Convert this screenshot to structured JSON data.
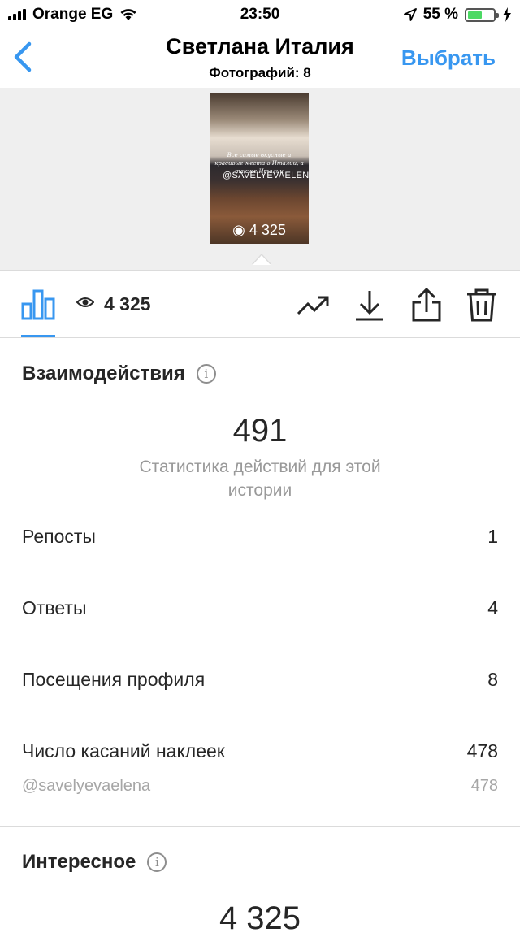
{
  "status": {
    "carrier": "Orange EG",
    "time": "23:50",
    "battery": "55 %",
    "battery_level": 0.55
  },
  "nav": {
    "title": "Светлана Италия",
    "subtitle": "Фотографий: 8",
    "select_label": "Выбрать"
  },
  "preview": {
    "caption_text": "Все самые вкусные и красивые места в Италии, а также Италии",
    "tag": "@SAVELYEVAELENA",
    "views": "4 325"
  },
  "toolbar": {
    "views": "4 325"
  },
  "interactions": {
    "title": "Взаимодействия",
    "total": "491",
    "caption": "Статистика действий для этой истории",
    "rows": [
      {
        "label": "Репосты",
        "value": "1"
      },
      {
        "label": "Ответы",
        "value": "4"
      },
      {
        "label": "Посещения профиля",
        "value": "8"
      },
      {
        "label": "Число касаний наклеек",
        "value": "478"
      }
    ],
    "sticker": {
      "label": "@savelyevaelena",
      "value": "478"
    }
  },
  "discovery": {
    "title": "Интересное",
    "total": "4 325"
  },
  "icons": [
    "back-chevron-icon",
    "eye-icon",
    "insights-icon",
    "promote-icon",
    "download-icon",
    "share-icon",
    "trash-icon",
    "info-icon"
  ],
  "colors": {
    "accent": "#3897f0",
    "text": "#262626",
    "muted": "#999999",
    "background_preview": "#efefef"
  }
}
